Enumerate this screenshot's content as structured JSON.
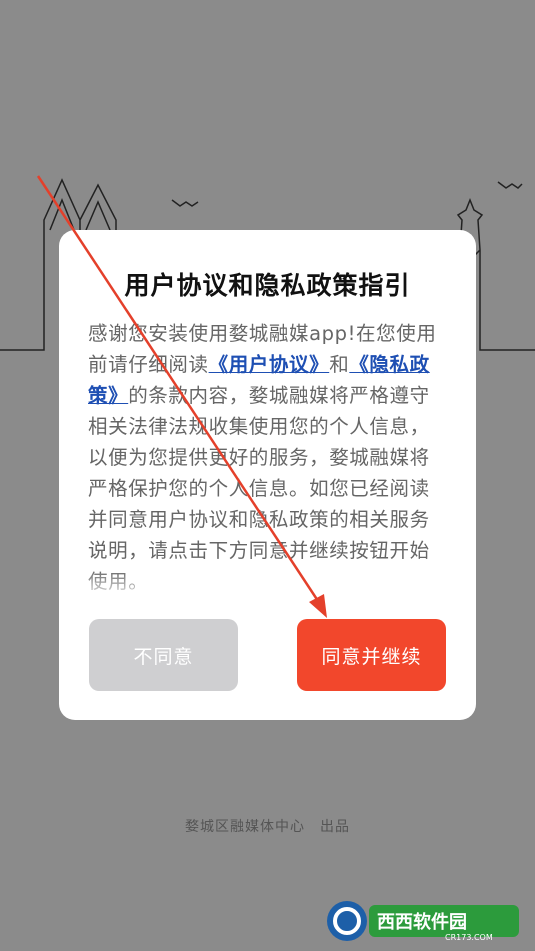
{
  "dialog": {
    "title": "用户协议和隐私政策指引",
    "body_part1": "感谢您安装使用婺城融媒app!在您使用前请仔细阅读",
    "user_agreement_link": "《用户协议》",
    "body_part2": "和",
    "privacy_policy_link": "《隐私政策》",
    "body_part3": "的条款内容，婺城融媒将严格遵守相关法律法规收集使用您的个人信息，以便为您提供更好的服务，婺城融媒将严格保护您的个人信息。如您已经阅读并同意用户协议和隐私政策的相关服务说明，请点击下方同意并继续按钮开始使用。",
    "disagree_label": "不同意",
    "agree_label": "同意并继续"
  },
  "footer": {
    "credit": "婺城区融媒体中心　出品"
  },
  "watermark": {
    "text": "西西软件园",
    "sub": "CR173.COM"
  },
  "colors": {
    "overlay": "#8b8b8b",
    "agree_button": "#f2472c",
    "disagree_button": "#cfcfd1",
    "link": "#1e4fb3"
  }
}
